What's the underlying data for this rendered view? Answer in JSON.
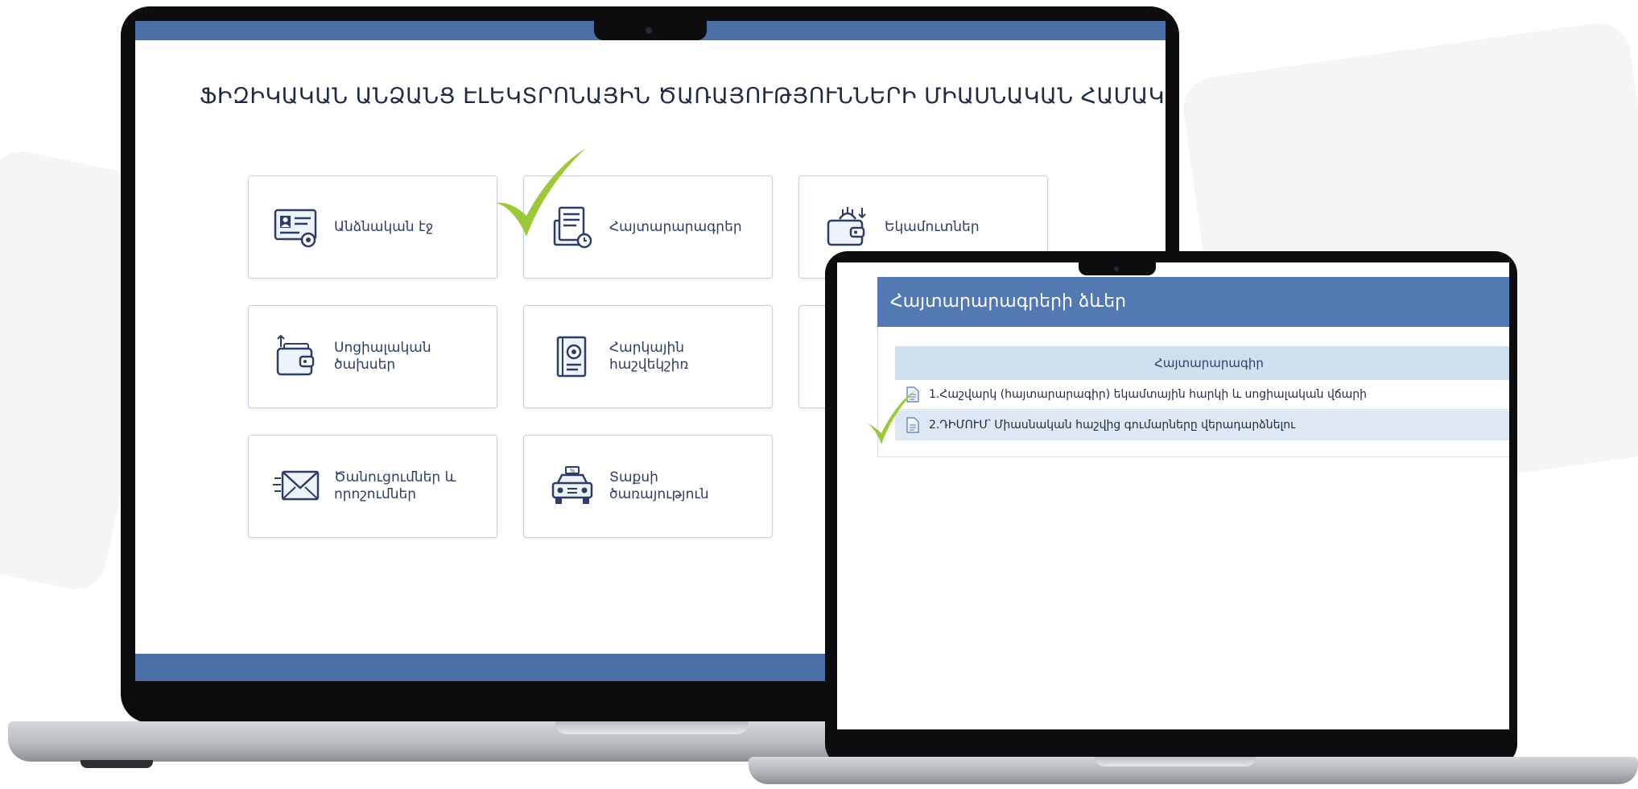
{
  "main_laptop": {
    "page_title": "ՖԻԶԻԿԱԿԱՆ ԱՆՁԱՆՑ ԷԼԵԿՏՐՈՆԱՅԻՆ ԾԱՌԱՅՈՒԹՅՈՒՆՆԵՐԻ ՄԻԱՍՆԱԿԱՆ ՀԱՄԱԿԱՐԳ",
    "tiles": [
      {
        "label": "Անձնական էջ",
        "icon": "id-card-gear-icon"
      },
      {
        "label": "Հայտարարագրեր",
        "icon": "document-stack-clock-icon"
      },
      {
        "label": "Եկամուտներ",
        "icon": "wallet-income-icon"
      },
      {
        "label": "Սոցիալական\nծախսեր",
        "icon": "wallet-spending-icon"
      },
      {
        "label": "Հարկային\nհաշվեկշիռ",
        "icon": "tax-book-coin-icon"
      },
      {
        "label": "Ծանուցումներ և\nորոշումներ",
        "icon": "envelope-icon"
      },
      {
        "label": "Տաքսի\nծառայություն",
        "icon": "taxi-icon"
      }
    ]
  },
  "secondary_laptop": {
    "panel_title": "Հայտարարագրերի ձևեր",
    "table": {
      "header": "Հայտարարագիր",
      "rows": [
        "1.Հաշվարկ (հայտարարագիր) եկամտային հարկի և սոցիալական վճարի",
        "2.ԴԻՄՈՒՄ՝ Միասնական հաշվից գումարները վերադարձնելու"
      ]
    }
  },
  "colors": {
    "brand_blue": "#4a6fa5",
    "panel_blue": "#5279b4",
    "table_header": "#cfdff0",
    "checkmark_green": "#9cc93a"
  }
}
